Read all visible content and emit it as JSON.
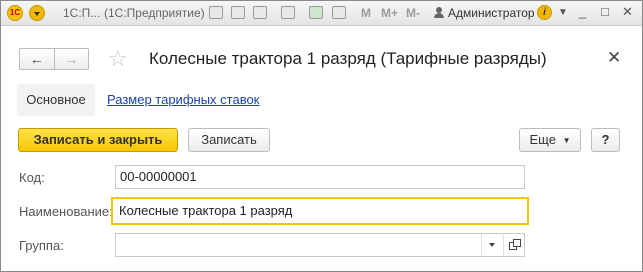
{
  "titlebar": {
    "logo_text": "1С",
    "short_title": "1С:П...",
    "app_title": "(1С:Предприятие)",
    "user": "Администратор",
    "m_labels": [
      "M",
      "M+",
      "M-"
    ]
  },
  "header": {
    "title": "Колесные трактора 1 разряд (Тарифные разряды)",
    "back": "←",
    "forward": "→",
    "star": "☆",
    "close": "✕"
  },
  "tabs": {
    "main": "Основное",
    "rates_link": "Размер тарифных ставок"
  },
  "commands": {
    "save_close": "Записать и закрыть",
    "save": "Записать",
    "more": "Еще",
    "help": "?"
  },
  "form": {
    "code_label": "Код:",
    "code_value": "00-00000001",
    "name_label": "Наименование:",
    "name_value": "Колесные трактора 1 разряд",
    "group_label": "Группа:",
    "group_value": ""
  },
  "colors": {
    "primary_button": "#f6c700",
    "link": "#1a3fb5",
    "focus_border": "#f0c60c"
  },
  "icons": [
    "logo-icon",
    "menu-dropdown-icon",
    "save-icon",
    "print-icon",
    "preview-icon",
    "mail-icon",
    "calculator-icon",
    "calendar-icon",
    "user-icon",
    "info-icon",
    "star-icon",
    "close-icon",
    "chevron-down-icon",
    "open-icon"
  ]
}
